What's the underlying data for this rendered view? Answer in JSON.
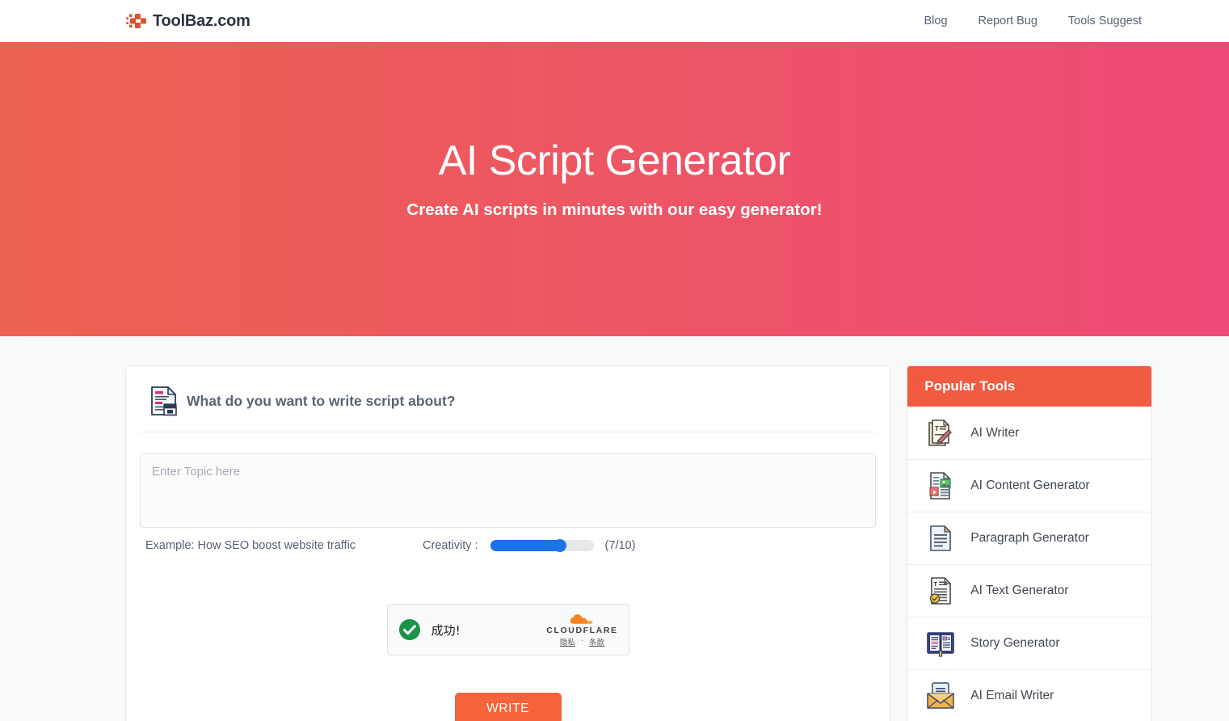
{
  "header": {
    "brand_name": "ToolBaz.com",
    "brand_logo_icon": "toolbaz-puzzle-logo-icon",
    "nav": [
      {
        "label": "Blog"
      },
      {
        "label": "Report Bug"
      },
      {
        "label": "Tools Suggest"
      }
    ]
  },
  "hero": {
    "title": "AI Script Generator",
    "subtitle": "Create AI scripts in minutes with our easy generator!",
    "gradient_from": "#ec6250",
    "gradient_to": "#ee4a78"
  },
  "main": {
    "prompt_icon": "script-document-clapperboard-icon",
    "prompt_heading": "What do you want to write script about?",
    "topic_input": {
      "value": "",
      "placeholder": "Enter Topic here"
    },
    "example_text": "Example: How SEO boost website traffic",
    "creativity": {
      "label": "Creativity :",
      "value": 7,
      "min": 0,
      "max": 10,
      "display": "(7/10)",
      "accent_color": "#1a73e8"
    },
    "captcha": {
      "status_icon": "green-check-circle-icon",
      "status_text": "成功!",
      "brand_icon": "cloudflare-cloud-icon",
      "brand_name": "CLOUDFLARE",
      "privacy_link": "隐私",
      "separator": "·",
      "terms_link": "条款"
    },
    "write_button": {
      "label": "WRITE",
      "color": "#f4633a"
    }
  },
  "sidebar": {
    "title": "Popular Tools",
    "header_color": "#f15b41",
    "items": [
      {
        "label": "AI Writer",
        "icon": "document-pencil-icon"
      },
      {
        "label": "AI Content Generator",
        "icon": "document-media-icon"
      },
      {
        "label": "Paragraph Generator",
        "icon": "document-lines-icon"
      },
      {
        "label": "AI Text Generator",
        "icon": "document-text-check-icon"
      },
      {
        "label": "Story Generator",
        "icon": "open-book-icon"
      },
      {
        "label": "AI Email Writer",
        "icon": "envelope-letter-icon"
      }
    ]
  }
}
